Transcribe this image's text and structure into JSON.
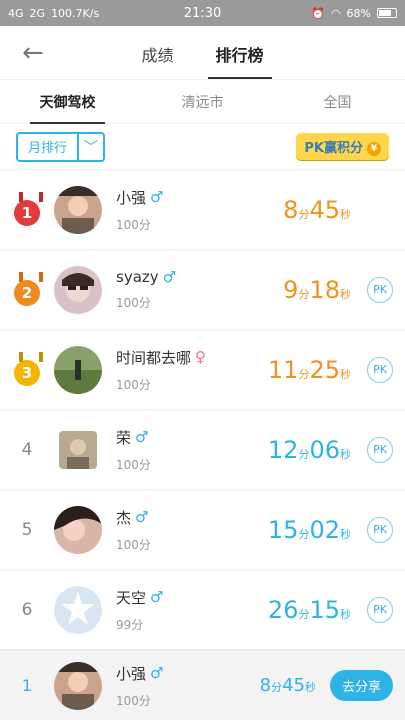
{
  "status": {
    "network_1": "4G",
    "network_2": "2G",
    "speed": "100.7K/s",
    "time": "21:30",
    "battery": "68%"
  },
  "header": {
    "tabs": [
      "成绩",
      "排行榜"
    ],
    "active_index": 1
  },
  "scope_tabs": [
    "天御驾校",
    "清远市",
    "全国"
  ],
  "filter": {
    "selected": "月排行"
  },
  "pk_badge": {
    "label": "PK赢积分",
    "coin": "¥"
  },
  "rows": [
    {
      "rank": "1",
      "name": "小强",
      "gender": "male",
      "score": "100分",
      "min": "8",
      "sec": "45",
      "unit_min": "分",
      "unit_sec": "秒",
      "pk": ""
    },
    {
      "rank": "2",
      "name": "syazy",
      "gender": "male",
      "score": "100分",
      "min": "9",
      "sec": "18",
      "unit_min": "分",
      "unit_sec": "秒",
      "pk": "PK"
    },
    {
      "rank": "3",
      "name": "时间都去哪",
      "gender": "female",
      "score": "100分",
      "min": "11",
      "sec": "25",
      "unit_min": "分",
      "unit_sec": "秒",
      "pk": "PK"
    },
    {
      "rank": "4",
      "name": "荣",
      "gender": "male",
      "score": "100分",
      "min": "12",
      "sec": "06",
      "unit_min": "分",
      "unit_sec": "秒",
      "pk": "PK"
    },
    {
      "rank": "5",
      "name": "杰",
      "gender": "male",
      "score": "100分",
      "min": "15",
      "sec": "02",
      "unit_min": "分",
      "unit_sec": "秒",
      "pk": "PK"
    },
    {
      "rank": "6",
      "name": "天空",
      "gender": "male",
      "score": "99分",
      "min": "26",
      "sec": "15",
      "unit_min": "分",
      "unit_sec": "秒",
      "pk": "PK"
    }
  ],
  "footer": {
    "rank": "1",
    "name": "小强",
    "gender": "male",
    "score": "100分",
    "min": "8",
    "sec": "45",
    "unit_min": "分",
    "unit_sec": "秒",
    "share": "去分享"
  },
  "symbols": {
    "male": "♂",
    "female": "♀"
  }
}
